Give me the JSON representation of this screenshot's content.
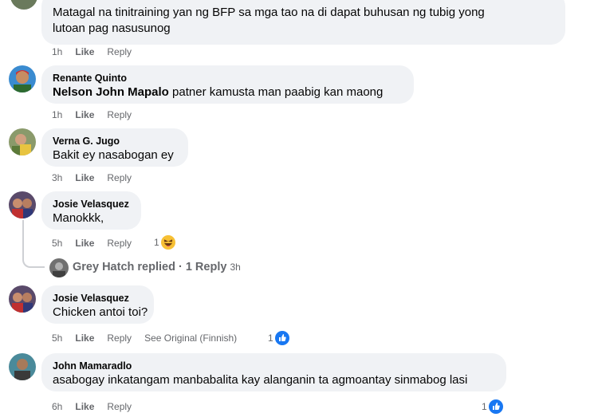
{
  "comments": [
    {
      "author": "",
      "lines": [
        "Matagal na tinitraining yan ng BFP sa mga tao na di dapat buhusan ng tubig yong",
        "lutoan pag nasusunog"
      ],
      "time": "1h",
      "like": "Like",
      "reply": "Reply"
    },
    {
      "author": "Renante Quinto",
      "mention": "Nelson John Mapalo",
      "text": " patner kamusta man paabig kan maong",
      "time": "1h",
      "like": "Like",
      "reply": "Reply"
    },
    {
      "author": "Verna G. Jugo",
      "text": "Bakit ey nasabogan ey",
      "time": "3h",
      "like": "Like",
      "reply": "Reply"
    },
    {
      "author": "Josie Velasquez",
      "text": "Manokkk,",
      "time": "5h",
      "like": "Like",
      "reply": "Reply",
      "reaction": {
        "count": "1",
        "icon": "haha-emoji"
      },
      "replies": {
        "author": "Grey Hatch",
        "label": "replied · 1 Reply",
        "time": "3h"
      }
    },
    {
      "author": "Josie Velasquez",
      "text": "Chicken antoi toi?",
      "time": "5h",
      "like": "Like",
      "reply": "Reply",
      "see_original": "See Original (Finnish)",
      "reaction": {
        "count": "1",
        "icon": "like-icon"
      }
    },
    {
      "author": "John Mamaradlo",
      "text": "asabogay inkatangam manbabalita kay alanganin ta agmoantay sinmabog lasi",
      "time": "6h",
      "like": "Like",
      "reply": "Reply",
      "reaction": {
        "count": "1",
        "icon": "like-icon"
      }
    }
  ],
  "colors": {
    "bubble": "#f0f2f5",
    "meta": "#65676b",
    "like_blue": "#1877f2",
    "haha_yellow": "#f7c034"
  }
}
